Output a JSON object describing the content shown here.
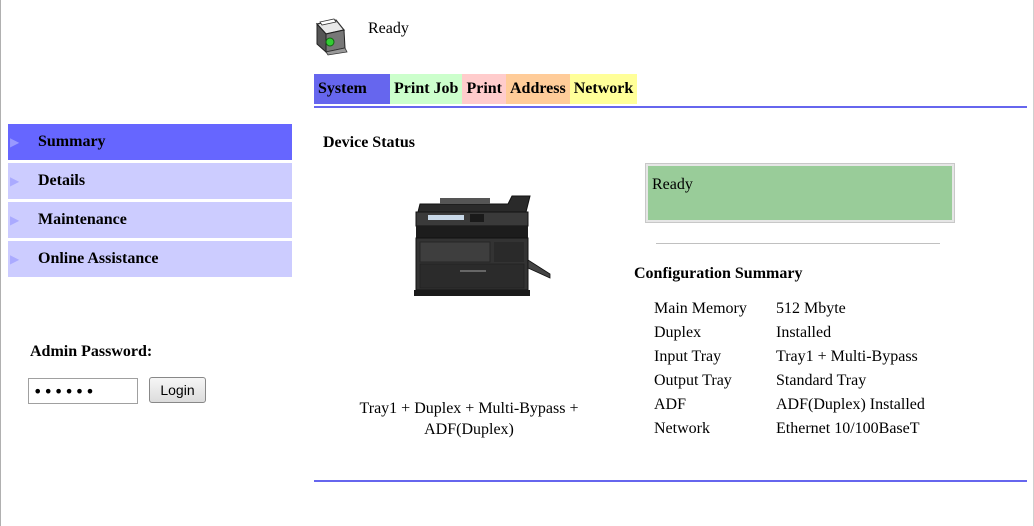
{
  "header": {
    "status_text": "Ready",
    "status_icon": "printer-ready-icon"
  },
  "tabs": [
    {
      "label": "System",
      "color": "#6666ee"
    },
    {
      "label": "Print Job",
      "color": "#ccffcc"
    },
    {
      "label": "Print",
      "color": "#ffcccc"
    },
    {
      "label": "Address",
      "color": "#ffcc99"
    },
    {
      "label": "Network",
      "color": "#ffff99"
    }
  ],
  "sidebar": {
    "items": [
      {
        "label": "Summary",
        "active": true
      },
      {
        "label": "Details"
      },
      {
        "label": "Maintenance"
      },
      {
        "label": "Online Assistance"
      }
    ]
  },
  "admin": {
    "label": "Admin Password:",
    "password_value": "••••••",
    "login_label": "Login"
  },
  "main": {
    "section_title": "Device Status",
    "device_status": "Ready",
    "tray_caption_line1": "Tray1 + Duplex + Multi-Bypass +",
    "tray_caption_line2": "ADF(Duplex)",
    "config_title": "Configuration Summary",
    "config": [
      {
        "key": "Main Memory",
        "value": "512 Mbyte"
      },
      {
        "key": "Duplex",
        "value": "Installed"
      },
      {
        "key": "Input Tray",
        "value": "Tray1 + Multi-Bypass"
      },
      {
        "key": "Output Tray",
        "value": "Standard Tray"
      },
      {
        "key": "ADF",
        "value": "ADF(Duplex) Installed"
      },
      {
        "key": "Network",
        "value": "Ethernet 10/100BaseT"
      }
    ]
  },
  "colors": {
    "accent": "#6666ee",
    "sidebar_active": "#6666ff",
    "sidebar_item": "#ccccff",
    "status_box": "#99cc99"
  }
}
